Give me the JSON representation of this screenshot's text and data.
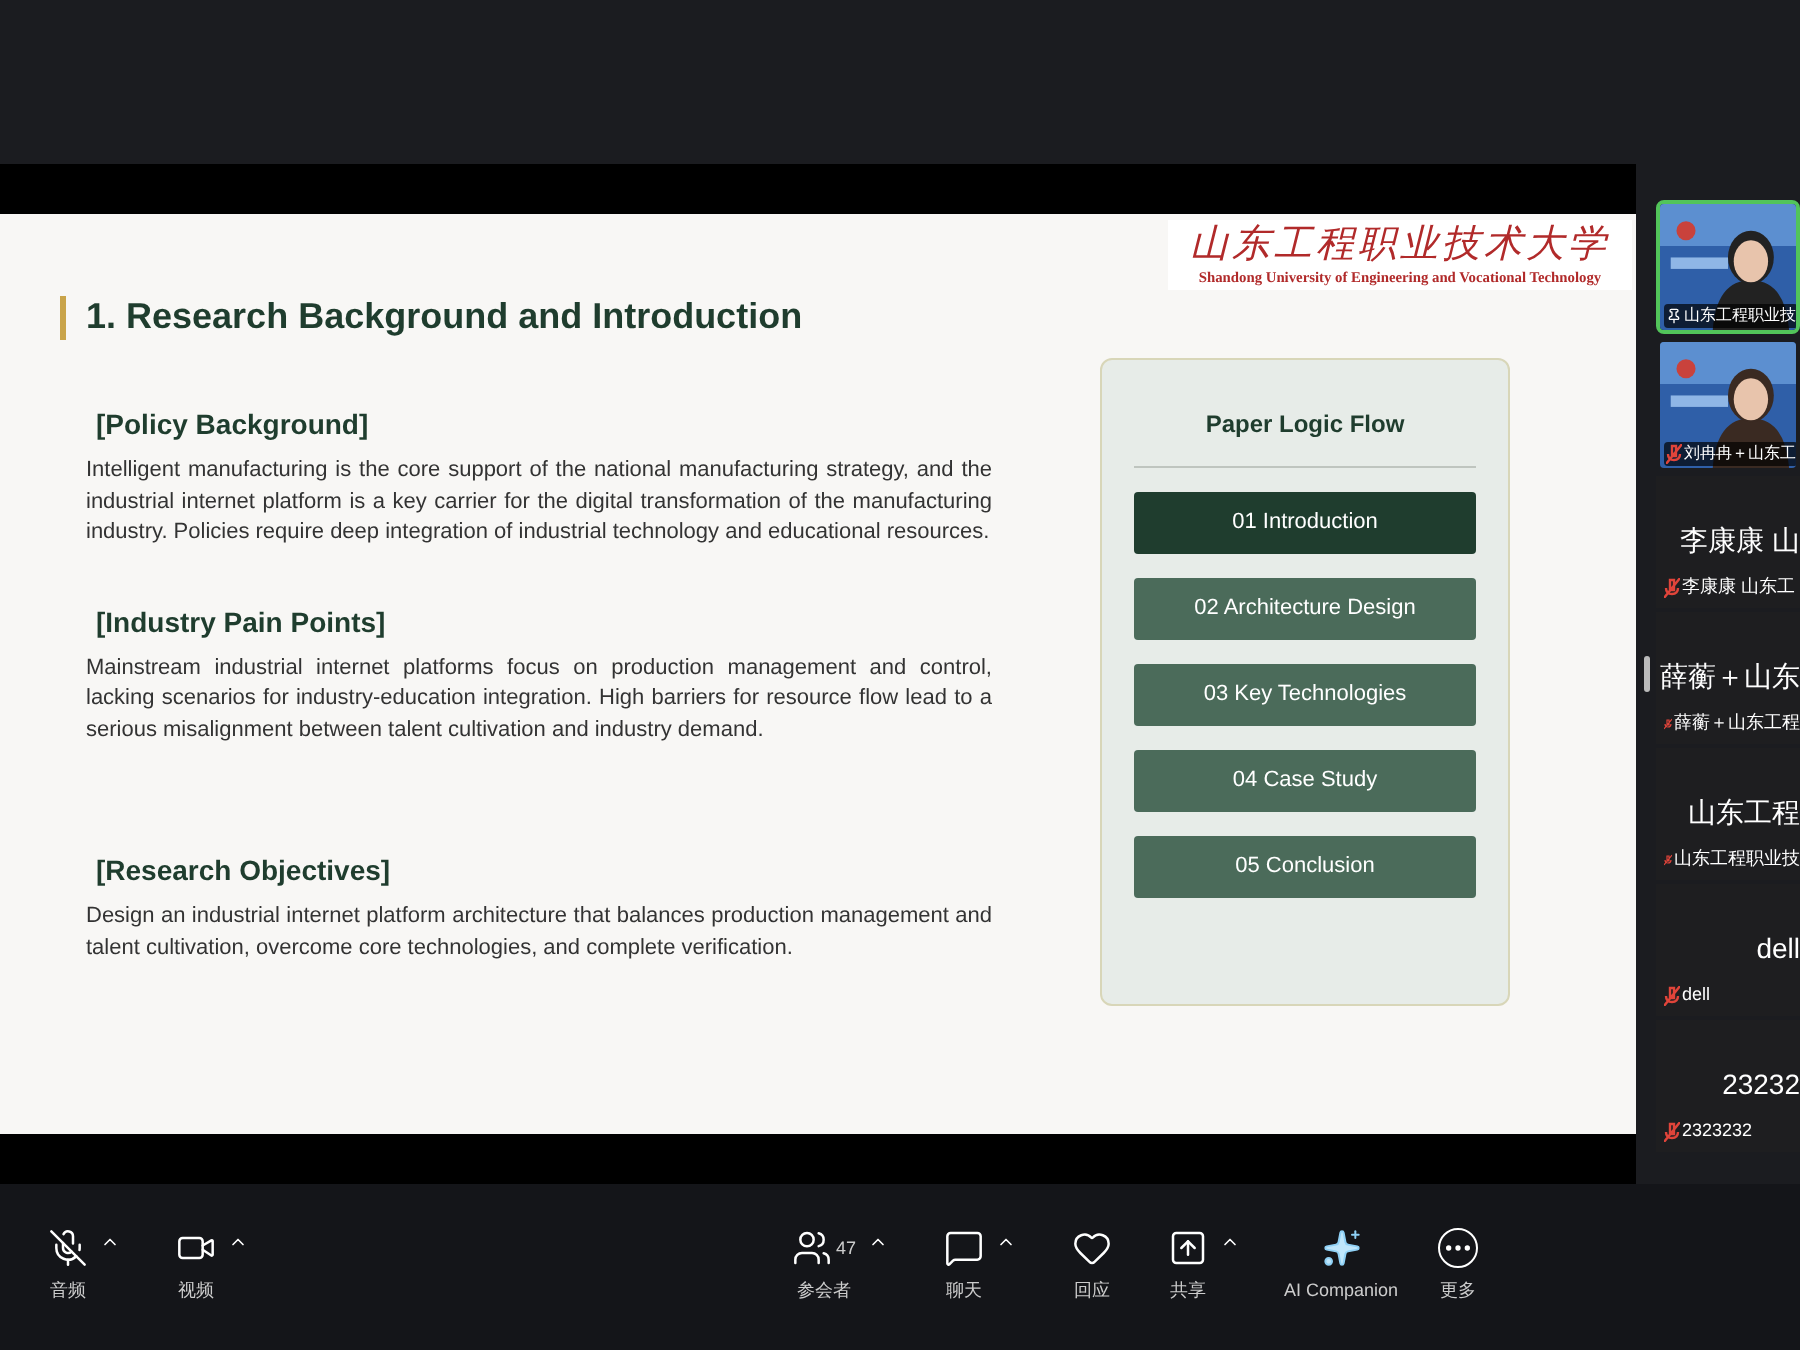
{
  "slide": {
    "logo": {
      "chinese": "山东工程职业技术大学",
      "english": "Shandong University of  Engineering and Vocational Technology"
    },
    "title": "1. Research Background and Introduction",
    "sections": [
      {
        "heading": "[Policy Background]",
        "body": "Intelligent manufacturing is the core support of the national manufacturing strategy, and the industrial internet platform is a key carrier for the digital transformation of the manufacturing industry. Policies require deep integration of industrial technology and educational resources."
      },
      {
        "heading": "[Industry Pain Points]",
        "body": "Mainstream industrial internet platforms focus on production management and control, lacking scenarios for industry-education integration. High barriers for resource flow lead to a serious misalignment between talent cultivation and industry demand."
      },
      {
        "heading": "[Research Objectives]",
        "body": "Design an industrial internet platform architecture that balances production management and talent cultivation, overcome core technologies, and complete verification."
      }
    ],
    "flow": {
      "title": "Paper Logic Flow",
      "steps": [
        {
          "label": "01 Introduction",
          "selected": true
        },
        {
          "label": "02 Architecture Design",
          "selected": false
        },
        {
          "label": "03 Key Technologies",
          "selected": false
        },
        {
          "label": "04 Case Study",
          "selected": false
        },
        {
          "label": "05 Conclusion",
          "selected": false
        }
      ]
    }
  },
  "participants": [
    {
      "kind": "video",
      "label": "山东工程职业技",
      "pinned": true,
      "active": true
    },
    {
      "kind": "video",
      "label": "刘冉冉＋山东工",
      "pinned": false,
      "active": false
    },
    {
      "kind": "name",
      "name": "李康康 山",
      "label": "李康康 山东工"
    },
    {
      "kind": "name",
      "name": "薛蘅＋山东",
      "label": "薛蘅＋山东工程"
    },
    {
      "kind": "name",
      "name": "山东工程",
      "label": "山东工程职业技"
    },
    {
      "kind": "name",
      "name": "dell",
      "label": "dell"
    },
    {
      "kind": "name",
      "name": "23232",
      "label": "2323232"
    }
  ],
  "toolbar": [
    {
      "kind": "mic",
      "label": "音频",
      "caret": true
    },
    {
      "kind": "video",
      "label": "视频",
      "caret": true
    },
    {
      "kind": "participants",
      "label": "参会者",
      "count": "47",
      "caret": true
    },
    {
      "kind": "chat",
      "label": "聊天",
      "caret": true
    },
    {
      "kind": "react",
      "label": "回应",
      "caret": false
    },
    {
      "kind": "share",
      "label": "共享",
      "caret": true
    },
    {
      "kind": "ai",
      "label": "AI Companion",
      "caret": false
    },
    {
      "kind": "more",
      "label": "更多",
      "caret": false
    }
  ]
}
